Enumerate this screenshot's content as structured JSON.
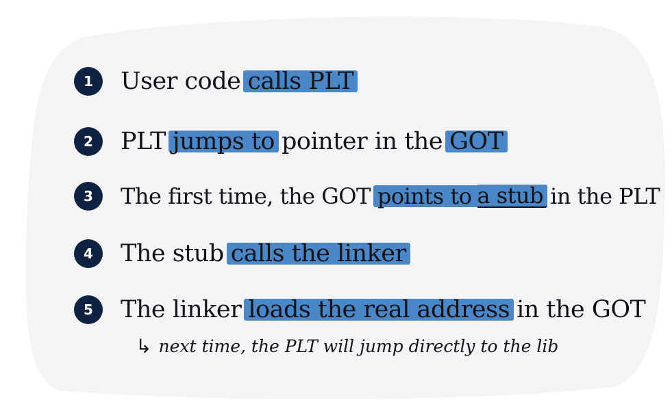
{
  "icons": {
    "note_arrow": "return-arrow-icon"
  },
  "colors": {
    "background_blob": "#f4f4f6",
    "highlight": "#4b86c6",
    "badge": "#0f2242",
    "ink": "#111318"
  },
  "steps": [
    {
      "number": "1",
      "segments": [
        {
          "text": "User code",
          "style": "plain"
        },
        {
          "text": "calls PLT",
          "style": "highlight"
        }
      ]
    },
    {
      "number": "2",
      "segments": [
        {
          "text": "PLT",
          "style": "plain"
        },
        {
          "text": "jumps to",
          "style": "highlight"
        },
        {
          "text": "pointer in the",
          "style": "plain"
        },
        {
          "text": "GOT",
          "style": "highlight"
        }
      ]
    },
    {
      "number": "3",
      "segments": [
        {
          "text": "The first time, the GOT",
          "style": "plain"
        },
        {
          "text": "points to",
          "style": "highlight"
        },
        {
          "text": "a stub",
          "style": "highlight-underline"
        },
        {
          "text": "in the PLT",
          "style": "plain"
        }
      ]
    },
    {
      "number": "4",
      "segments": [
        {
          "text": "The stub",
          "style": "plain"
        },
        {
          "text": "calls the linker",
          "style": "highlight"
        }
      ]
    },
    {
      "number": "5",
      "segments": [
        {
          "text": "The linker",
          "style": "plain"
        },
        {
          "text": "loads the real address",
          "style": "highlight"
        },
        {
          "text": "in the GOT",
          "style": "plain"
        }
      ]
    }
  ],
  "note": {
    "arrow": "↳",
    "text": "next time, the PLT will jump directly to the lib"
  }
}
